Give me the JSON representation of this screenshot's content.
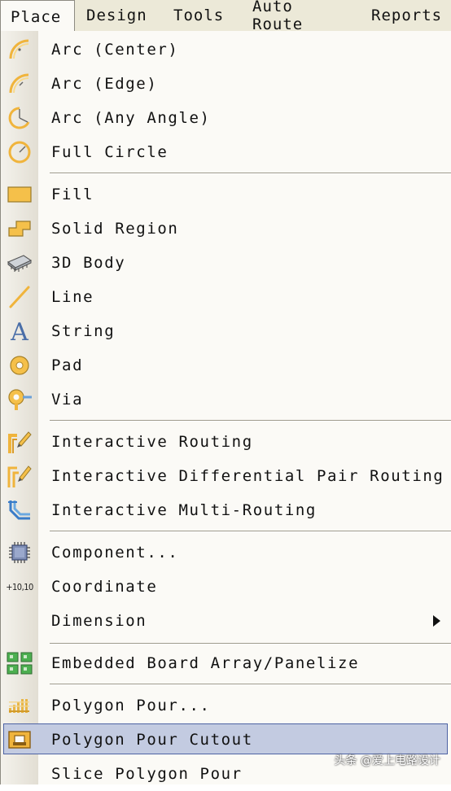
{
  "menubar": {
    "items": [
      "Place",
      "Design",
      "Tools",
      "Auto Route",
      "Reports"
    ],
    "active": "Place"
  },
  "menu": {
    "items": [
      {
        "label": "Arc (Center)",
        "icon": "arc-center-icon"
      },
      {
        "label": "Arc (Edge)",
        "icon": "arc-edge-icon"
      },
      {
        "label": "Arc (Any Angle)",
        "icon": "arc-any-angle-icon"
      },
      {
        "label": "Full Circle",
        "icon": "full-circle-icon"
      },
      {
        "label": "Fill",
        "icon": "fill-icon"
      },
      {
        "label": "Solid Region",
        "icon": "solid-region-icon"
      },
      {
        "label": "3D Body",
        "icon": "3d-body-icon"
      },
      {
        "label": "Line",
        "icon": "line-icon"
      },
      {
        "label": "String",
        "icon": "string-icon"
      },
      {
        "label": "Pad",
        "icon": "pad-icon"
      },
      {
        "label": "Via",
        "icon": "via-icon"
      },
      {
        "label": "Interactive Routing",
        "icon": "interactive-routing-icon"
      },
      {
        "label": "Interactive Differential Pair Routing",
        "icon": "differential-pair-icon"
      },
      {
        "label": "Interactive Multi-Routing",
        "icon": "multi-routing-icon"
      },
      {
        "label": "Component...",
        "icon": "component-icon"
      },
      {
        "label": "Coordinate",
        "icon": "coordinate-icon",
        "icon_text": "+10,10"
      },
      {
        "label": "Dimension",
        "icon": "",
        "submenu": true
      },
      {
        "label": "Embedded Board Array/Panelize",
        "icon": "board-array-icon"
      },
      {
        "label": "Polygon Pour...",
        "icon": "polygon-pour-icon"
      },
      {
        "label": "Polygon Pour Cutout",
        "icon": "polygon-pour-cutout-icon",
        "highlighted": true
      },
      {
        "label": "Slice Polygon Pour",
        "icon": ""
      }
    ]
  },
  "watermark": "头条 @爱上电路设计",
  "colors": {
    "menubar_bg": "#ece9d8",
    "menu_bg": "#fbfaf6",
    "highlight_bg": "#c3cbe1",
    "highlight_border": "#4e63a4",
    "icon_orange": "#f0b43c"
  }
}
